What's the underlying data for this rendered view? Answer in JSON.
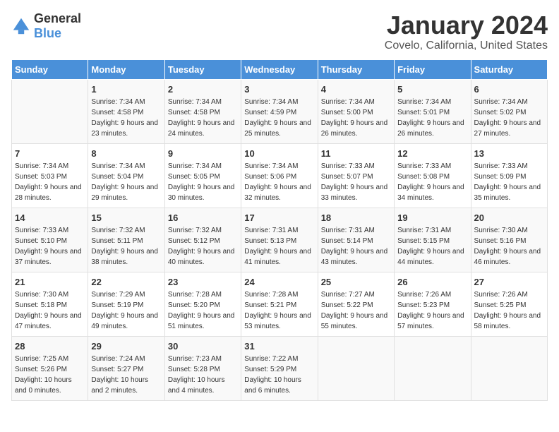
{
  "logo": {
    "text_general": "General",
    "text_blue": "Blue"
  },
  "calendar": {
    "title": "January 2024",
    "subtitle": "Covelo, California, United States"
  },
  "headers": [
    "Sunday",
    "Monday",
    "Tuesday",
    "Wednesday",
    "Thursday",
    "Friday",
    "Saturday"
  ],
  "weeks": [
    [
      {
        "day": "",
        "sunrise": "",
        "sunset": "",
        "daylight": ""
      },
      {
        "day": "1",
        "sunrise": "Sunrise: 7:34 AM",
        "sunset": "Sunset: 4:58 PM",
        "daylight": "Daylight: 9 hours and 23 minutes."
      },
      {
        "day": "2",
        "sunrise": "Sunrise: 7:34 AM",
        "sunset": "Sunset: 4:58 PM",
        "daylight": "Daylight: 9 hours and 24 minutes."
      },
      {
        "day": "3",
        "sunrise": "Sunrise: 7:34 AM",
        "sunset": "Sunset: 4:59 PM",
        "daylight": "Daylight: 9 hours and 25 minutes."
      },
      {
        "day": "4",
        "sunrise": "Sunrise: 7:34 AM",
        "sunset": "Sunset: 5:00 PM",
        "daylight": "Daylight: 9 hours and 26 minutes."
      },
      {
        "day": "5",
        "sunrise": "Sunrise: 7:34 AM",
        "sunset": "Sunset: 5:01 PM",
        "daylight": "Daylight: 9 hours and 26 minutes."
      },
      {
        "day": "6",
        "sunrise": "Sunrise: 7:34 AM",
        "sunset": "Sunset: 5:02 PM",
        "daylight": "Daylight: 9 hours and 27 minutes."
      }
    ],
    [
      {
        "day": "7",
        "sunrise": "Sunrise: 7:34 AM",
        "sunset": "Sunset: 5:03 PM",
        "daylight": "Daylight: 9 hours and 28 minutes."
      },
      {
        "day": "8",
        "sunrise": "Sunrise: 7:34 AM",
        "sunset": "Sunset: 5:04 PM",
        "daylight": "Daylight: 9 hours and 29 minutes."
      },
      {
        "day": "9",
        "sunrise": "Sunrise: 7:34 AM",
        "sunset": "Sunset: 5:05 PM",
        "daylight": "Daylight: 9 hours and 30 minutes."
      },
      {
        "day": "10",
        "sunrise": "Sunrise: 7:34 AM",
        "sunset": "Sunset: 5:06 PM",
        "daylight": "Daylight: 9 hours and 32 minutes."
      },
      {
        "day": "11",
        "sunrise": "Sunrise: 7:33 AM",
        "sunset": "Sunset: 5:07 PM",
        "daylight": "Daylight: 9 hours and 33 minutes."
      },
      {
        "day": "12",
        "sunrise": "Sunrise: 7:33 AM",
        "sunset": "Sunset: 5:08 PM",
        "daylight": "Daylight: 9 hours and 34 minutes."
      },
      {
        "day": "13",
        "sunrise": "Sunrise: 7:33 AM",
        "sunset": "Sunset: 5:09 PM",
        "daylight": "Daylight: 9 hours and 35 minutes."
      }
    ],
    [
      {
        "day": "14",
        "sunrise": "Sunrise: 7:33 AM",
        "sunset": "Sunset: 5:10 PM",
        "daylight": "Daylight: 9 hours and 37 minutes."
      },
      {
        "day": "15",
        "sunrise": "Sunrise: 7:32 AM",
        "sunset": "Sunset: 5:11 PM",
        "daylight": "Daylight: 9 hours and 38 minutes."
      },
      {
        "day": "16",
        "sunrise": "Sunrise: 7:32 AM",
        "sunset": "Sunset: 5:12 PM",
        "daylight": "Daylight: 9 hours and 40 minutes."
      },
      {
        "day": "17",
        "sunrise": "Sunrise: 7:31 AM",
        "sunset": "Sunset: 5:13 PM",
        "daylight": "Daylight: 9 hours and 41 minutes."
      },
      {
        "day": "18",
        "sunrise": "Sunrise: 7:31 AM",
        "sunset": "Sunset: 5:14 PM",
        "daylight": "Daylight: 9 hours and 43 minutes."
      },
      {
        "day": "19",
        "sunrise": "Sunrise: 7:31 AM",
        "sunset": "Sunset: 5:15 PM",
        "daylight": "Daylight: 9 hours and 44 minutes."
      },
      {
        "day": "20",
        "sunrise": "Sunrise: 7:30 AM",
        "sunset": "Sunset: 5:16 PM",
        "daylight": "Daylight: 9 hours and 46 minutes."
      }
    ],
    [
      {
        "day": "21",
        "sunrise": "Sunrise: 7:30 AM",
        "sunset": "Sunset: 5:18 PM",
        "daylight": "Daylight: 9 hours and 47 minutes."
      },
      {
        "day": "22",
        "sunrise": "Sunrise: 7:29 AM",
        "sunset": "Sunset: 5:19 PM",
        "daylight": "Daylight: 9 hours and 49 minutes."
      },
      {
        "day": "23",
        "sunrise": "Sunrise: 7:28 AM",
        "sunset": "Sunset: 5:20 PM",
        "daylight": "Daylight: 9 hours and 51 minutes."
      },
      {
        "day": "24",
        "sunrise": "Sunrise: 7:28 AM",
        "sunset": "Sunset: 5:21 PM",
        "daylight": "Daylight: 9 hours and 53 minutes."
      },
      {
        "day": "25",
        "sunrise": "Sunrise: 7:27 AM",
        "sunset": "Sunset: 5:22 PM",
        "daylight": "Daylight: 9 hours and 55 minutes."
      },
      {
        "day": "26",
        "sunrise": "Sunrise: 7:26 AM",
        "sunset": "Sunset: 5:23 PM",
        "daylight": "Daylight: 9 hours and 57 minutes."
      },
      {
        "day": "27",
        "sunrise": "Sunrise: 7:26 AM",
        "sunset": "Sunset: 5:25 PM",
        "daylight": "Daylight: 9 hours and 58 minutes."
      }
    ],
    [
      {
        "day": "28",
        "sunrise": "Sunrise: 7:25 AM",
        "sunset": "Sunset: 5:26 PM",
        "daylight": "Daylight: 10 hours and 0 minutes."
      },
      {
        "day": "29",
        "sunrise": "Sunrise: 7:24 AM",
        "sunset": "Sunset: 5:27 PM",
        "daylight": "Daylight: 10 hours and 2 minutes."
      },
      {
        "day": "30",
        "sunrise": "Sunrise: 7:23 AM",
        "sunset": "Sunset: 5:28 PM",
        "daylight": "Daylight: 10 hours and 4 minutes."
      },
      {
        "day": "31",
        "sunrise": "Sunrise: 7:22 AM",
        "sunset": "Sunset: 5:29 PM",
        "daylight": "Daylight: 10 hours and 6 minutes."
      },
      {
        "day": "",
        "sunrise": "",
        "sunset": "",
        "daylight": ""
      },
      {
        "day": "",
        "sunrise": "",
        "sunset": "",
        "daylight": ""
      },
      {
        "day": "",
        "sunrise": "",
        "sunset": "",
        "daylight": ""
      }
    ]
  ]
}
